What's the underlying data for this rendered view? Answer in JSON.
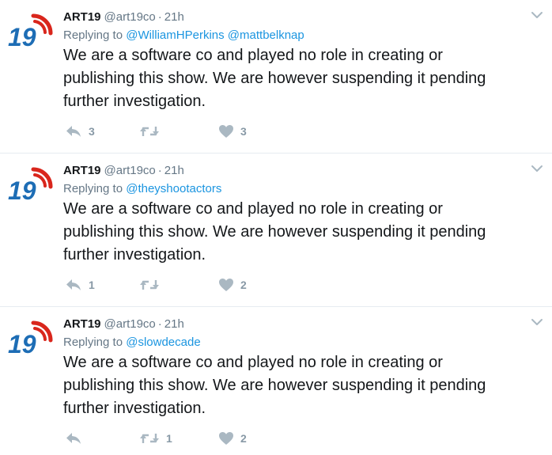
{
  "colors": {
    "name": "#14171a",
    "meta": "#657786",
    "mention": "#1b95e0",
    "icon": "#aab8c2",
    "count": "#8899a6",
    "avatar_blue": "#1d6db5",
    "avatar_red": "#d9261c"
  },
  "avatar": {
    "label": "19"
  },
  "tweets": [
    {
      "name": "ART19",
      "handle": "@art19co",
      "separator": "·",
      "time": "21h",
      "replying_prefix": "Replying to",
      "mentions": [
        "@WilliamHPerkins",
        "@mattbelknap"
      ],
      "text": "We are a software co and played no role in creating or\npublishing this show. We are however suspending it pending\nfurther investigation.",
      "replies": "3",
      "retweets": "",
      "likes": "3"
    },
    {
      "name": "ART19",
      "handle": "@art19co",
      "separator": "·",
      "time": "21h",
      "replying_prefix": "Replying to",
      "mentions": [
        "@theyshootactors"
      ],
      "text": "We are a software co and played no role in creating or\npublishing this show. We are however suspending it pending\nfurther investigation.",
      "replies": "1",
      "retweets": "",
      "likes": "2"
    },
    {
      "name": "ART19",
      "handle": "@art19co",
      "separator": "·",
      "time": "21h",
      "replying_prefix": "Replying to",
      "mentions": [
        "@slowdecade"
      ],
      "text": "We are a software co and played no role in creating or\npublishing this show. We are however suspending it pending\nfurther investigation.",
      "replies": "",
      "retweets": "1",
      "likes": "2"
    }
  ],
  "icons": {
    "reply": "reply-icon",
    "retweet": "retweet-icon",
    "like": "heart-icon",
    "more": "chevron-down-icon",
    "avatar": "art19-logo-icon"
  }
}
